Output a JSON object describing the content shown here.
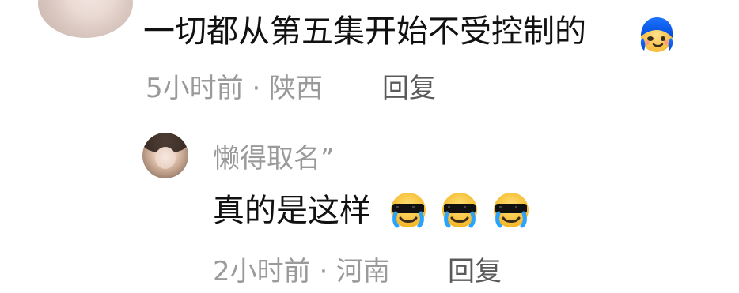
{
  "comment": {
    "text": "一切都从第五集开始不受控制的",
    "emoji": "shy-face-with-blue-hair-icon",
    "meta": "5小时前 · 陕西",
    "reply_label": "回复"
  },
  "reply": {
    "username": "懒得取名”",
    "text": "真的是这样",
    "emojis": [
      "cool-crying-face-icon",
      "cool-crying-face-icon",
      "cool-crying-face-icon"
    ],
    "meta": "2小时前 · 河南",
    "reply_label": "回复"
  }
}
